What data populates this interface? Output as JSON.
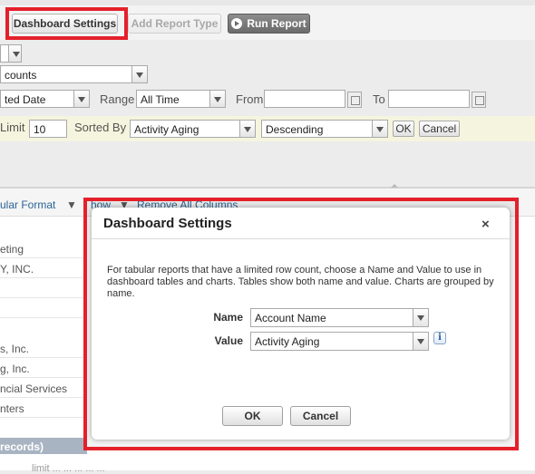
{
  "toolbar": {
    "dashboard_settings": "Dashboard Settings",
    "add_report_type": "Add Report Type",
    "run_report": "Run Report"
  },
  "filters": {
    "row1_value": "",
    "row2_value": "counts",
    "date_field_value": "ted Date",
    "range_label": "Range",
    "range_value": "All Time",
    "from_label": "From",
    "to_label": "To",
    "limit_label": "Limit",
    "limit_value": "10",
    "sorted_by_label": "Sorted By",
    "sorted_by_value": "Activity Aging",
    "order_value": "Descending",
    "ok": "OK",
    "cancel": "Cancel"
  },
  "report": {
    "format_link": "ular Format",
    "show_link": "how",
    "remove_all_columns": "Remove All Columns",
    "rows": [
      "eting",
      "Y, INC.",
      "",
      "",
      "s, Inc.",
      "g, Inc.",
      "ncial Services",
      "nters"
    ],
    "group_bar": "records)",
    "footer_text": "limit ... ... ... ... ..."
  },
  "dialog": {
    "title": "Dashboard Settings",
    "close": "×",
    "description": "For tabular reports that have a limited row count, choose a Name and Value to use in dashboard tables and charts. Tables show both name and value. Charts are grouped by name.",
    "name_label": "Name",
    "name_value": "Account Name",
    "value_label": "Value",
    "value_value": "Activity Aging",
    "info": "i",
    "ok": "OK",
    "cancel": "Cancel"
  },
  "colors": {
    "highlight": "#e4202b",
    "link": "#2a6496",
    "yellow_bar": "#f5f4de"
  }
}
